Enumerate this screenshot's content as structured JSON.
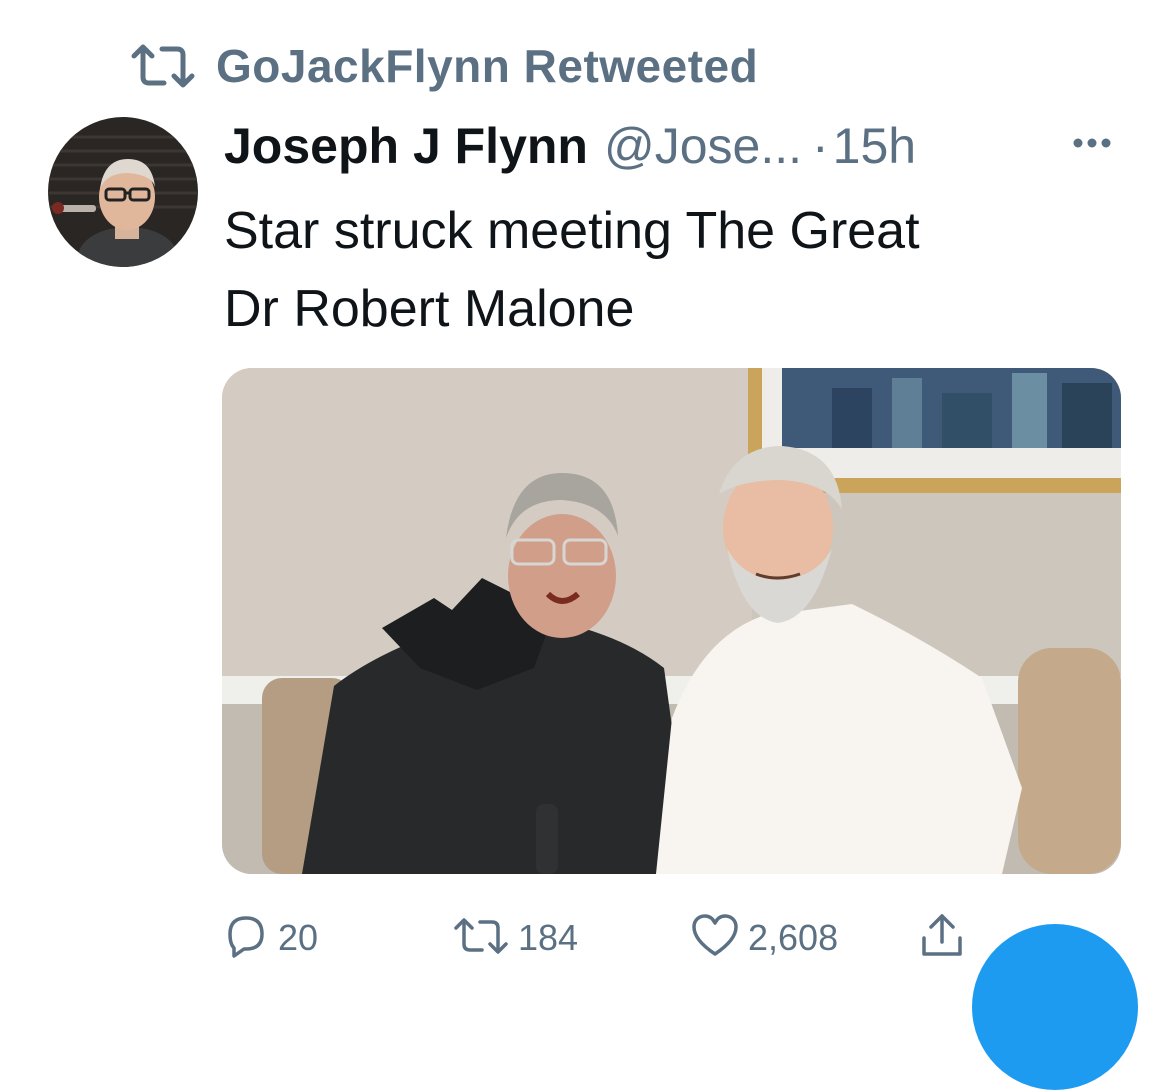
{
  "retweet_context": {
    "label": "GoJackFlynn Retweeted",
    "icon": "retweet-icon"
  },
  "tweet": {
    "author_name": "Joseph J Flynn",
    "handle": "@Jose...",
    "separator": "·",
    "time": "15h",
    "text_line1": "Star struck meeting The Great",
    "text_line2": "Dr Robert Malone",
    "media_icon": "photo-two-men-seated"
  },
  "actions": {
    "reply_count": "20",
    "retweet_count": "184",
    "like_count": "2,608"
  },
  "icons": {
    "reply": "reply-icon",
    "retweet": "retweet-icon",
    "like": "heart-icon",
    "share": "share-icon",
    "more": "more-icon",
    "compose": "compose-fab"
  },
  "colors": {
    "text_primary": "#0f1419",
    "text_secondary": "#5b7083",
    "accent": "#1d9bf0",
    "background": "#ffffff"
  }
}
